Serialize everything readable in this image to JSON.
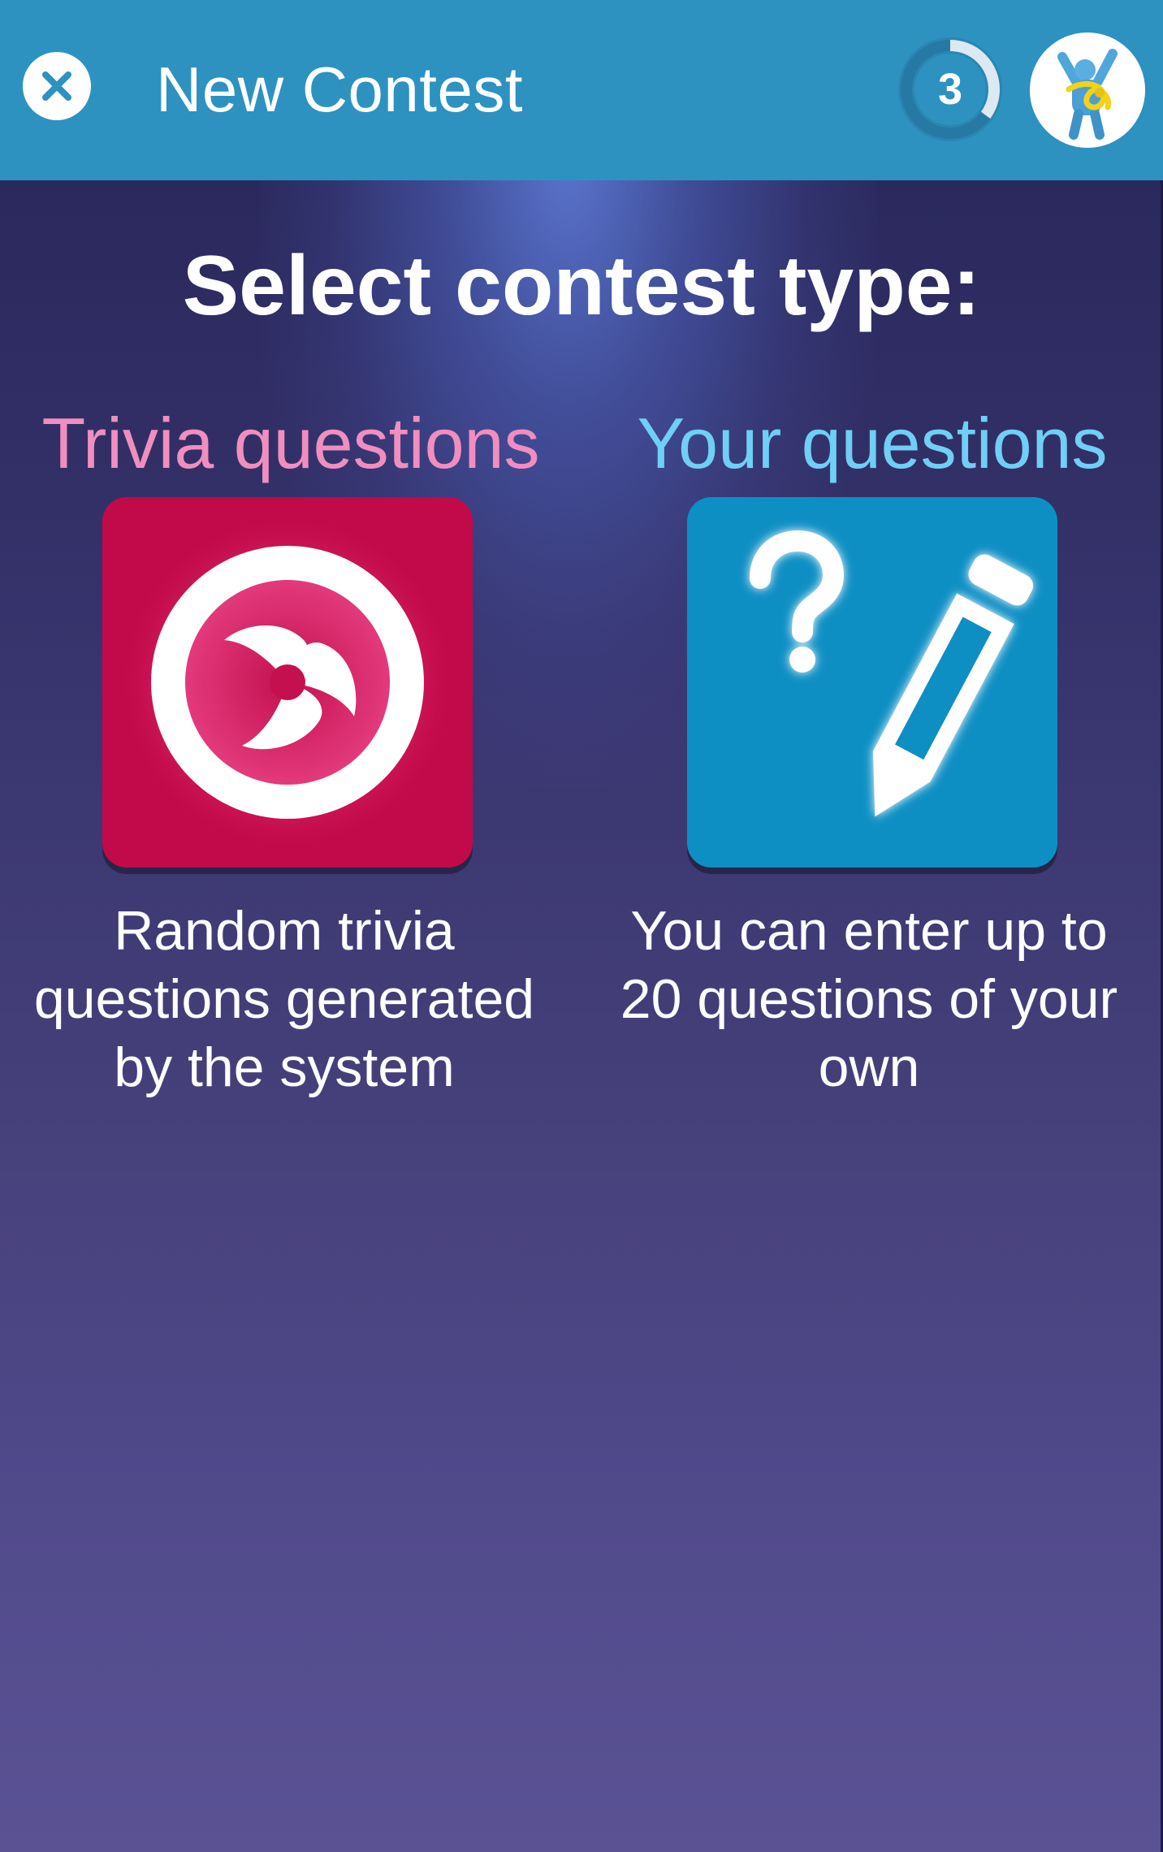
{
  "header": {
    "title": "New Contest",
    "level": "3",
    "level_progress": 0.35,
    "close_icon": "close-icon",
    "avatar_icon": "mascot-avatar-icon",
    "color": "#2d92c0"
  },
  "main": {
    "heading": "Select contest type:",
    "options": [
      {
        "title": "Trivia questions",
        "description": "Random trivia questions generated by the system",
        "icon": "swirl-icon",
        "title_color": "#f08ec0",
        "tile_color": "#c20a4a"
      },
      {
        "title": "Your questions",
        "description": "You can enter up to 20 questions of your own",
        "icon": "question-pencil-icon",
        "title_color": "#6fcff5",
        "tile_color": "#0e8fc4"
      }
    ]
  }
}
